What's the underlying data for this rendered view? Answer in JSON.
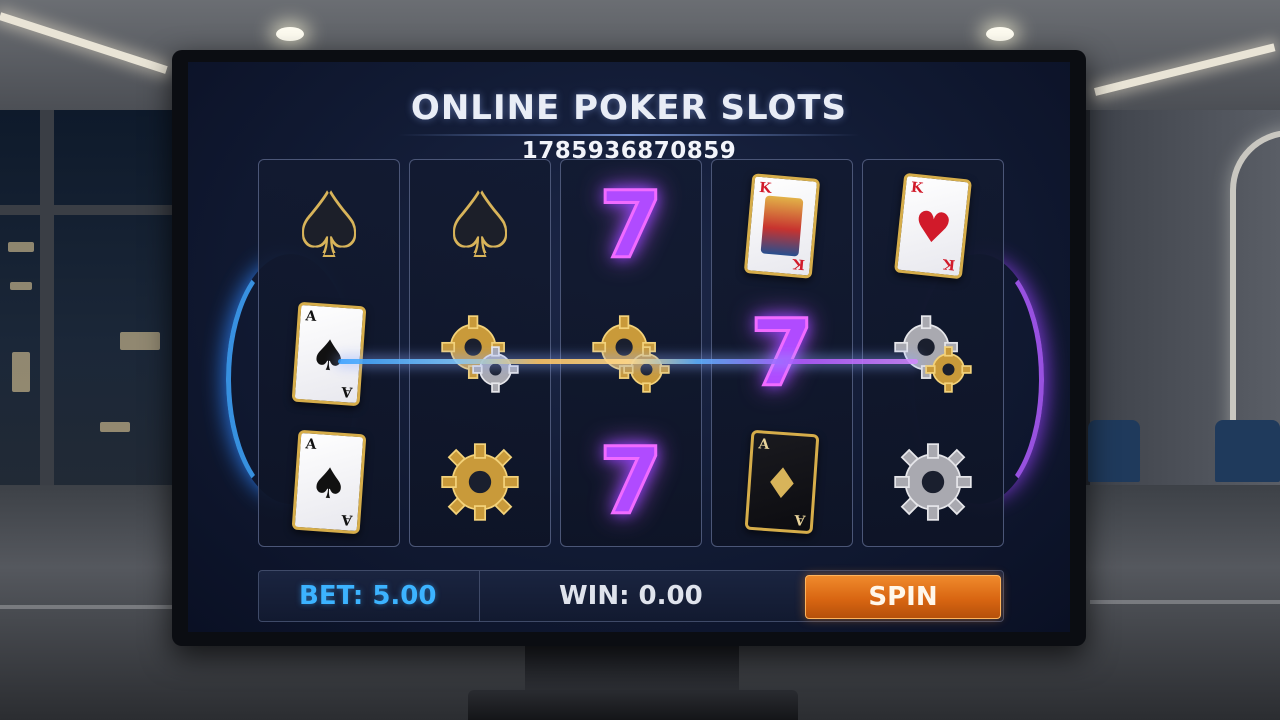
{
  "game": {
    "title": "ONLINE POKER SLOTS",
    "game_id": "1785936870859"
  },
  "reels": [
    {
      "symbols": [
        "gold-spade-icon",
        "ace-of-spades-card-icon",
        "ace-of-spades-card-icon"
      ]
    },
    {
      "symbols": [
        "gold-spade-icon",
        "gold-gears-icon",
        "gold-gear-icon"
      ]
    },
    {
      "symbols": [
        "purple-seven-icon",
        "gold-gears-icon",
        "purple-seven-icon"
      ]
    },
    {
      "symbols": [
        "king-of-hearts-card-icon",
        "purple-seven-icon",
        "ace-of-diamonds-card-icon"
      ]
    },
    {
      "symbols": [
        "king-of-hearts-card-icon",
        "silver-gears-icon",
        "silver-gear-icon"
      ]
    }
  ],
  "cards": {
    "ace_rank": "A",
    "king_rank": "K",
    "spade_suit": "♠",
    "heart_suit": "♥",
    "diamond_suit": "♦"
  },
  "seven_glyph": "7",
  "controls": {
    "bet_text": "BET: 5.00",
    "win_text": "WIN: 0.00",
    "spin_label": "SPIN"
  },
  "colors": {
    "bet_accent": "#3cb3ff",
    "spin_button": "#d96612",
    "seven_glow": "#b04bff",
    "gold_trim": "#d6ad4a"
  }
}
